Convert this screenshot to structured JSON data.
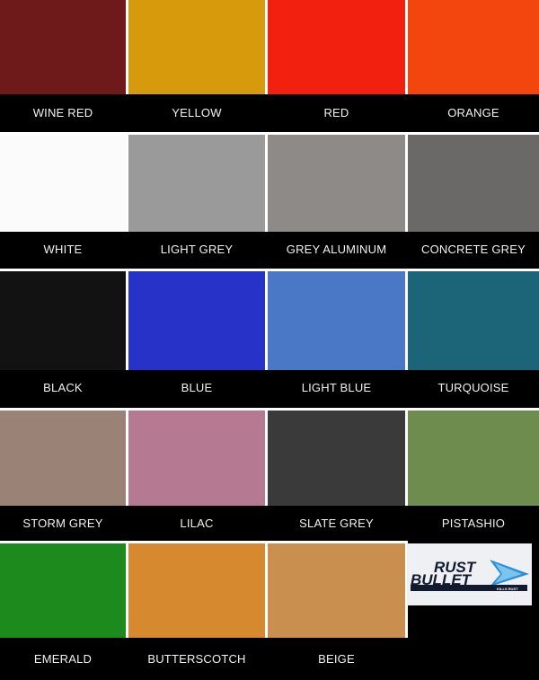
{
  "swatches": [
    {
      "name": "WINE RED",
      "color": "#6e1a1a"
    },
    {
      "name": "YELLOW",
      "color": "#d69a0c"
    },
    {
      "name": "RED",
      "color": "#f2200f"
    },
    {
      "name": "ORANGE",
      "color": "#f2460e"
    },
    {
      "name": "WHITE",
      "color": "#fbfbfb"
    },
    {
      "name": "LIGHT GREY",
      "color": "#9b9a9a"
    },
    {
      "name": "GREY ALUMINUM",
      "color": "#8d8a87"
    },
    {
      "name": "CONCRETE GREY",
      "color": "#6a6968"
    },
    {
      "name": "BLACK",
      "color": "#121212"
    },
    {
      "name": "BLUE",
      "color": "#2632c8"
    },
    {
      "name": "LIGHT BLUE",
      "color": "#4a78c6"
    },
    {
      "name": "TURQUOISE",
      "color": "#1c6478"
    },
    {
      "name": "STORM GREY",
      "color": "#9a8276"
    },
    {
      "name": "LILAC",
      "color": "#b57a92"
    },
    {
      "name": "SLATE GREY",
      "color": "#3b3a3b"
    },
    {
      "name": "PISTASHIO",
      "color": "#6e8c4e"
    },
    {
      "name": "EMERALD",
      "color": "#1d8a1d"
    },
    {
      "name": "BUTTERSCOTCH",
      "color": "#d6892e"
    },
    {
      "name": "BEIGE",
      "color": "#c98f4e"
    }
  ],
  "logo": {
    "line1": "RUST",
    "line2": "BULLET",
    "tagline": "KILLS RUST",
    "accent": "#2a8fd8",
    "dark": "#111a2e"
  }
}
